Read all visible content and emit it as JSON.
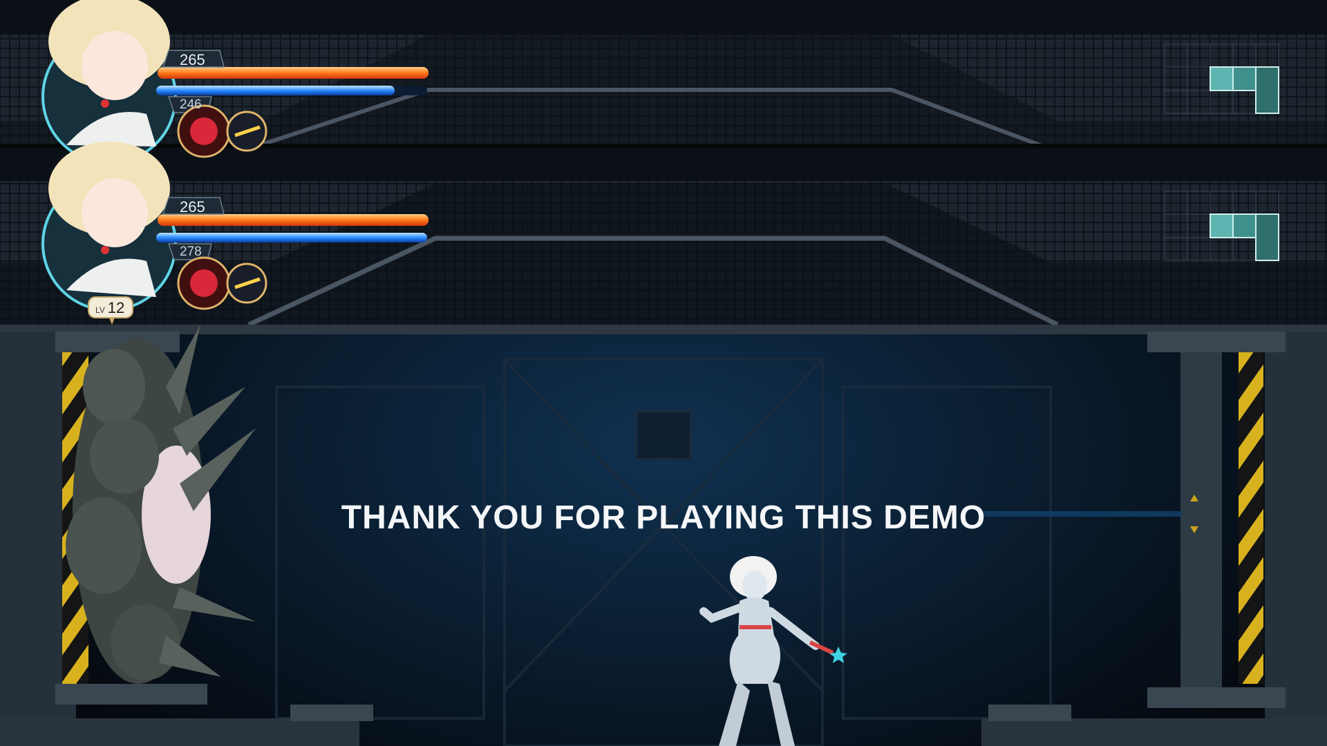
{
  "hud_top": {
    "hp_value": "265",
    "mp_value": "246",
    "hp_fill": 1.0,
    "mp_fill": 0.88
  },
  "hud_main": {
    "hp_value": "265",
    "mp_value": "278",
    "hp_fill": 1.0,
    "mp_fill": 1.0,
    "level_label": "LV",
    "level_value": "12"
  },
  "message": "THANK YOU FOR PLAYING THIS DEMO",
  "colors": {
    "hp": "#ff7a1a",
    "mp": "#2a8cff",
    "minimap_room": "#5fb3b0",
    "minimap_grid": "#3a4450"
  },
  "icons": [
    "character-portrait-icon",
    "crimson-orb-skill-icon",
    "energy-shot-skill-icon",
    "minimap-icon",
    "creature-hive-icon",
    "heroine-sprite-icon"
  ]
}
